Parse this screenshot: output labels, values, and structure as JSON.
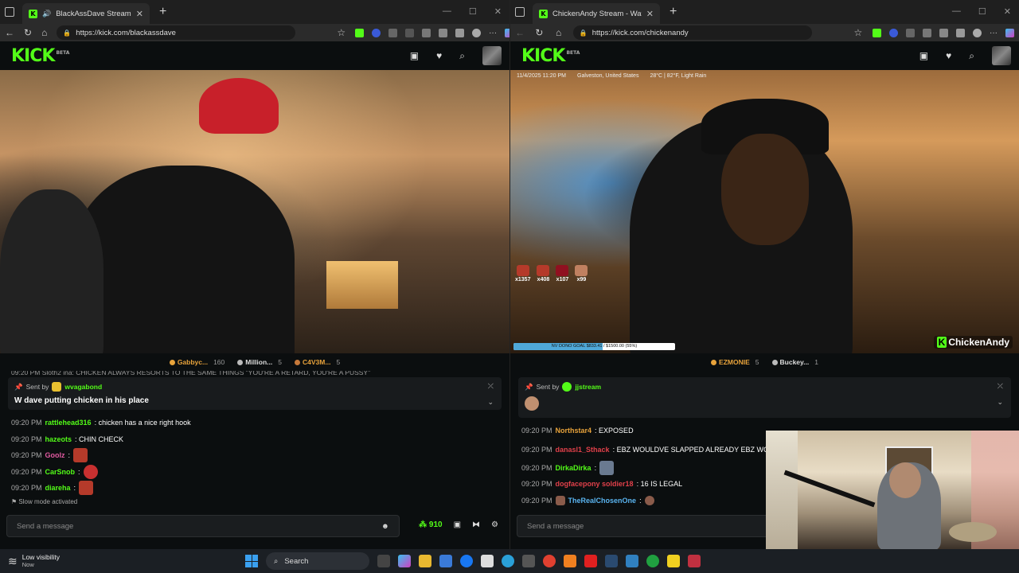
{
  "left": {
    "tab_title": "BlackAssDave Stream - Watch",
    "url": "https://kick.com/blackassdave",
    "logo": "KICK",
    "logo_badge": "BETA",
    "gifters": [
      {
        "name": "Gabbyc...",
        "count": "160",
        "color": "#e8a33b"
      },
      {
        "name": "Million...",
        "count": "5",
        "color": "#bbbbbb"
      },
      {
        "name": "C4V3M...",
        "count": "5",
        "color": "#c6793a"
      }
    ],
    "chat_cut_line": "09:20 PM Sloth2 ina: CHICKEN ALWAYS RESORTS TO THE SAME THINGS \"YOU'RE A RETARD, YOU'RE A PUSSY\"",
    "pinned": {
      "sent_by": "Sent by",
      "user": "wvagabond",
      "message": "W dave putting chicken in his place"
    },
    "messages": [
      {
        "time": "09:20 PM",
        "user": "rattlehead316",
        "color": "#53fc18",
        "text": ": chicken has a nice right hook",
        "emote": false
      },
      {
        "time": "09:20 PM",
        "user": "hazeots",
        "color": "#53fc18",
        "text": ": CHIN CHECK",
        "emote": false
      },
      {
        "time": "09:20 PM",
        "user": "Goolz",
        "color": "#e05aa0",
        "text": ":",
        "emote": true
      },
      {
        "time": "09:20 PM",
        "user": "CarSnob",
        "color": "#53fc18",
        "text": ":",
        "emote": true
      },
      {
        "time": "09:20 PM",
        "user": "diareha",
        "color": "#53fc18",
        "text": ":",
        "emote": true
      }
    ],
    "slow_mode": "Slow mode activated",
    "composer_placeholder": "Send a message",
    "points": "910"
  },
  "right": {
    "tab_title": "ChickenAndy Stream - Watch",
    "url": "https://kick.com/chickenandy",
    "logo": "KICK",
    "logo_badge": "BETA",
    "overlay": {
      "datetime": "11/4/2025 11:20 PM",
      "location": "Galveston, United States",
      "weather": "28°C | 82°F, Light Rain"
    },
    "emote_counts": [
      "x1357",
      "x408",
      "x107",
      "x99"
    ],
    "goal_text": "NV DONO GOAL $833.41 / $1500.00 (55%)",
    "goal_progress": 0.55,
    "watermark": "ChickenAndy",
    "gifters": [
      {
        "name": "EZMONIE",
        "count": "5",
        "color": "#e8a33b"
      },
      {
        "name": "Buckey...",
        "count": "1",
        "color": "#bbbbbb"
      }
    ],
    "pinned": {
      "sent_by": "Sent by",
      "user": "jjstream"
    },
    "messages": [
      {
        "time": "09:20 PM",
        "user": "Northstar4",
        "color": "#e8a33b",
        "text": ": EXPOSED",
        "emote": false
      },
      {
        "time": "09:20 PM",
        "user": "danasl1_Sthack",
        "color": "#e0404a",
        "text": ": EBZ WOULDVE SLAPPED ALREADY  EBZ WO",
        "emote": false
      },
      {
        "time": "09:20 PM",
        "user": "DirkaDirka",
        "color": "#53fc18",
        "text": ":",
        "emote": true
      },
      {
        "time": "09:20 PM",
        "user": "dogfacepony soldier18",
        "color": "#e0404a",
        "text": ": 16 IS LEGAL",
        "emote": false
      },
      {
        "time": "09:20 PM",
        "user": "TheRealChosenOne",
        "color": "#5ab4f0",
        "text": ":",
        "emote": true
      }
    ],
    "composer_placeholder": "Send a message"
  },
  "taskbar": {
    "weather_title": "Low visibility",
    "weather_sub": "Now",
    "search_label": "Search"
  }
}
